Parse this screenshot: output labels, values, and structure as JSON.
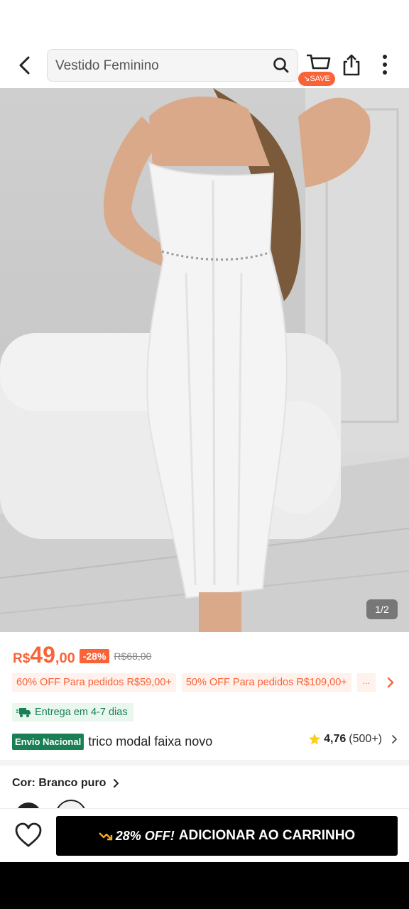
{
  "header": {
    "search_text": "Vestido Feminino",
    "save_badge": "SAVE"
  },
  "icons": [
    "back-arrow-icon",
    "search-icon",
    "cart-icon",
    "share-icon",
    "more-vertical-icon",
    "truck-icon",
    "star-icon",
    "chevron-right-icon",
    "heart-icon",
    "trend-down-icon"
  ],
  "colors": {
    "accent": "#fa6338",
    "green": "#198055",
    "cta": "#000000"
  },
  "gallery": {
    "counter": "1/2"
  },
  "price": {
    "currency": "R$",
    "integer": "49",
    "decimal": ",00",
    "discount": "-28%",
    "original": "R$68,00"
  },
  "promos": [
    "60% OFF Para pedidos R$59,00+",
    "50% OFF Para pedidos R$109,00+",
    "..."
  ],
  "delivery": "Entrega em 4-7 dias",
  "product": {
    "badge": "Envio Nacional",
    "title": "trico modal faixa novo",
    "rating": "4,76",
    "reviews": "(500+)"
  },
  "variant": {
    "label": "Cor: Branco puro"
  },
  "bottom": {
    "cta_promo": "28% OFF!",
    "cta_label": "ADICIONAR AO CARRINHO"
  }
}
